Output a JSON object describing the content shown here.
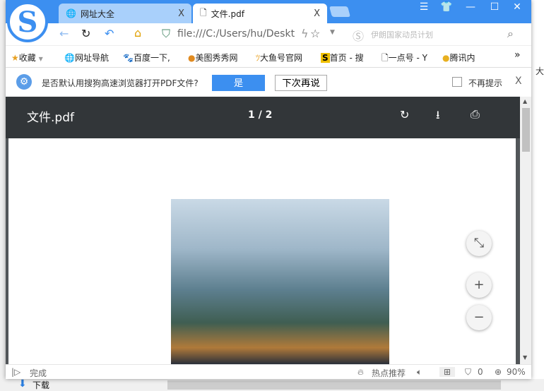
{
  "tabs": [
    {
      "label": "网址大全",
      "close": "X"
    },
    {
      "label": "文件.pdf",
      "close": "X"
    }
  ],
  "window_controls": [
    "☰",
    "👕",
    "—",
    "☐",
    "✕"
  ],
  "address": {
    "url": "file:///C:/Users/hu/Deskt",
    "search_placeholder": "伊朗国家动员计划"
  },
  "bookmarks": [
    {
      "label": "收藏"
    },
    {
      "label": "网址导航"
    },
    {
      "label": "百度一下,"
    },
    {
      "label": "美图秀秀网"
    },
    {
      "label": "大鱼号官网"
    },
    {
      "label": "首页 - 搜"
    },
    {
      "label": "一点号 - Y"
    },
    {
      "label": "腾讯内"
    }
  ],
  "bookmarks_more": "»",
  "notification": {
    "text": "是否默认用搜狗高速浏览器打开PDF文件?",
    "yes": "是",
    "later": "下次再说",
    "dont_remind": "不再提示",
    "close": "X"
  },
  "pdf": {
    "title": "文件.pdf",
    "page_indicator": "1 / 2"
  },
  "status": {
    "text": "完成",
    "hot": "热点推荐",
    "adblock_count": "0",
    "zoom": "90%"
  },
  "taskbar": {
    "download": "下载"
  },
  "side": {
    "right_text": "大"
  }
}
